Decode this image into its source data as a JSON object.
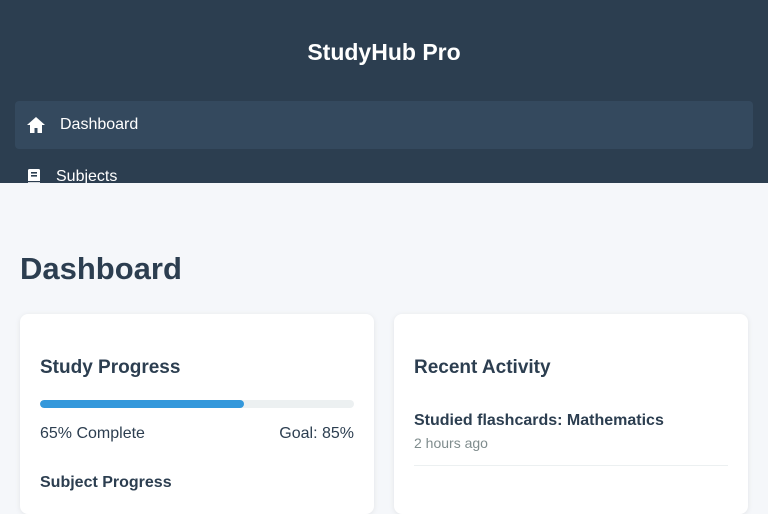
{
  "app": {
    "title": "StudyHub Pro"
  },
  "nav": {
    "items": [
      {
        "label": "Dashboard",
        "icon": "home-icon",
        "active": true
      },
      {
        "label": "Subjects",
        "icon": "book-icon",
        "active": false
      }
    ]
  },
  "page": {
    "title": "Dashboard"
  },
  "study_progress": {
    "title": "Study Progress",
    "progress_fraction": 0.65,
    "complete_label": "65% Complete",
    "goal_label": "Goal: 85%",
    "subsection_title": "Subject Progress"
  },
  "recent_activity": {
    "title": "Recent Activity",
    "items": [
      {
        "title": "Studied flashcards: Mathematics",
        "time": "2 hours ago"
      }
    ]
  },
  "colors": {
    "header": "#2c3e50",
    "nav_active": "#34495e",
    "accent": "#3498db",
    "background": "#f5f7fa",
    "muted_text": "#7f8c8d"
  }
}
